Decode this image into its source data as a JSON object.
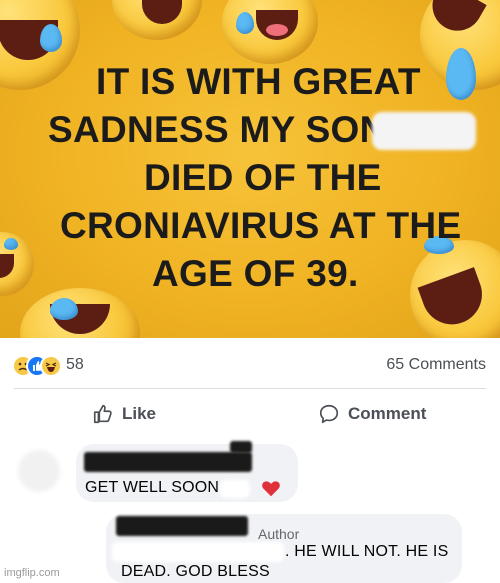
{
  "post": {
    "image_lines": [
      "IT IS WITH GREAT",
      "SADNESS MY SON",
      "DIED OF THE",
      "CRONIAVIRUS AT THE",
      "AGE OF 39."
    ],
    "background_color": "#f0b323"
  },
  "reactions": {
    "icons": [
      "sad-reaction",
      "like-reaction",
      "haha-reaction"
    ],
    "count": "58",
    "comments_count": "65 Comments"
  },
  "actions": {
    "like_label": "Like",
    "comment_label": "Comment"
  },
  "comments": [
    {
      "text": "GET WELL SOON",
      "has_heart": true
    },
    {
      "badge": "Author",
      "text_line1": ". HE WILL NOT. HE IS",
      "text_line2": "DEAD. GOD BLESS"
    }
  ],
  "watermark": "imgflip.com",
  "colors": {
    "facebook_blue": "#1877f2",
    "bubble_bg": "#f0f2f5",
    "heart_red": "#e0303a"
  }
}
